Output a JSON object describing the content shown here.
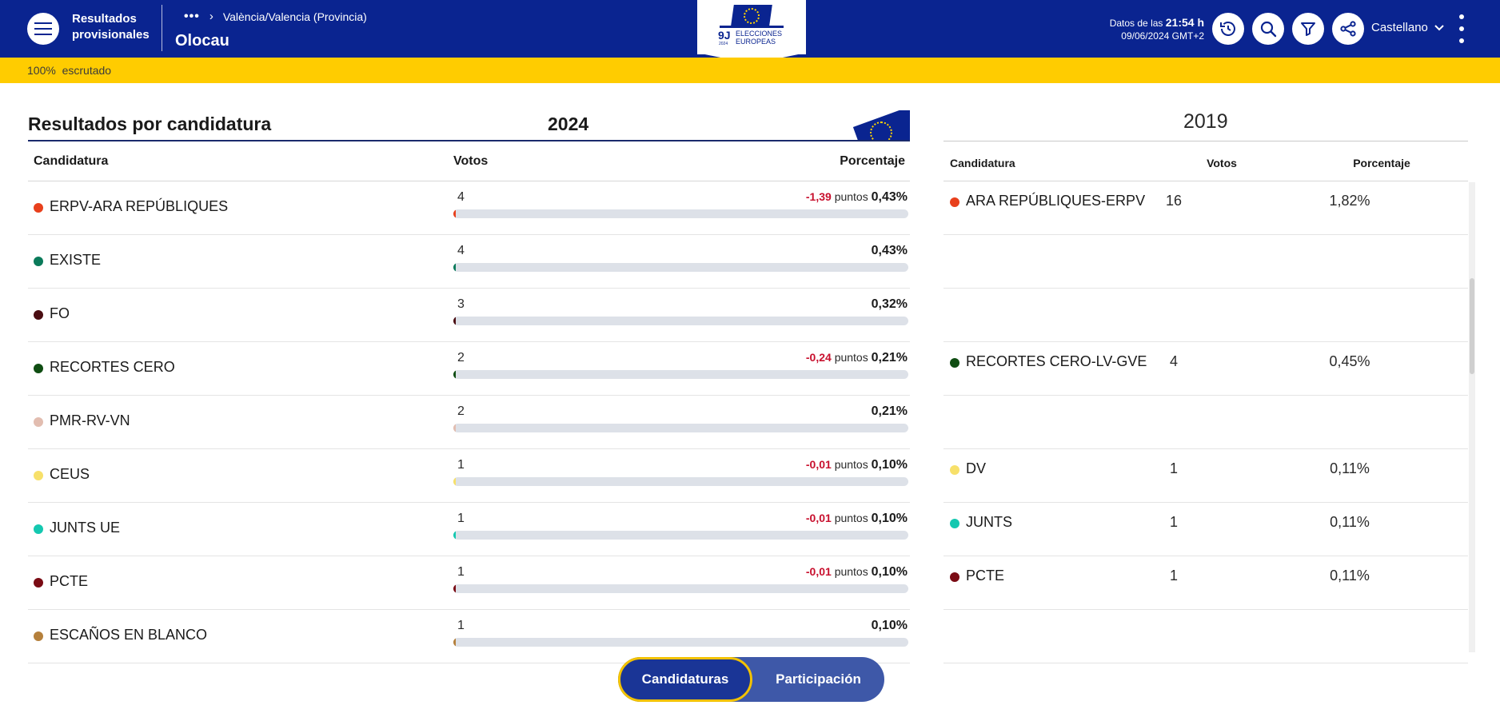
{
  "header": {
    "brand": "Resultados provisionales",
    "breadcrumb_more": "•••",
    "breadcrumb_item": "València/Valencia (Provincia)",
    "place": "Olocau",
    "logo": {
      "badge": "9J",
      "year": "2024",
      "line1": "ELECCIONES",
      "line2": "EUROPEAS"
    },
    "data_prefix": "Datos de las",
    "data_time": "21:54 h",
    "data_date": "09/06/2024 GMT+2",
    "language": "Castellano",
    "icons": [
      "history-icon",
      "search-icon",
      "filter-icon",
      "share-icon"
    ]
  },
  "status": {
    "percent": "100%",
    "label": "escrutado"
  },
  "section": {
    "title": "Resultados por candidatura",
    "year_current": "2024",
    "year_previous": "2019"
  },
  "table_2024": {
    "headers": [
      "Candidatura",
      "Votos",
      "Porcentaje"
    ],
    "delta_unit": "puntos",
    "rows": [
      {
        "name": "ERPV-ARA REPÚBLIQUES",
        "votes": "4",
        "delta": "-1,39",
        "pct": "0,43%",
        "pct_value": 0.43,
        "color": "#e8401c"
      },
      {
        "name": "EXISTE",
        "votes": "4",
        "delta": "",
        "pct": "0,43%",
        "pct_value": 0.43,
        "color": "#0a7a5a"
      },
      {
        "name": "FO",
        "votes": "3",
        "delta": "",
        "pct": "0,32%",
        "pct_value": 0.32,
        "color": "#4a0d12"
      },
      {
        "name": "RECORTES CERO",
        "votes": "2",
        "delta": "-0,24",
        "pct": "0,21%",
        "pct_value": 0.21,
        "color": "#0f4d12"
      },
      {
        "name": "PMR-RV-VN",
        "votes": "2",
        "delta": "",
        "pct": "0,21%",
        "pct_value": 0.21,
        "color": "#e2bdb0"
      },
      {
        "name": "CEUS",
        "votes": "1",
        "delta": "-0,01",
        "pct": "0,10%",
        "pct_value": 0.1,
        "color": "#f7e06a"
      },
      {
        "name": "JUNTS UE",
        "votes": "1",
        "delta": "-0,01",
        "pct": "0,10%",
        "pct_value": 0.1,
        "color": "#14c8b0"
      },
      {
        "name": "PCTE",
        "votes": "1",
        "delta": "-0,01",
        "pct": "0,10%",
        "pct_value": 0.1,
        "color": "#7a0b14"
      },
      {
        "name": "ESCAÑOS EN BLANCO",
        "votes": "1",
        "delta": "",
        "pct": "0,10%",
        "pct_value": 0.1,
        "color": "#b5803c"
      }
    ]
  },
  "table_2019": {
    "headers": [
      "Candidatura",
      "Votos",
      "Porcentaje"
    ],
    "rows": [
      {
        "name": "ARA REPÚBLIQUES-ERPV",
        "votes": "16",
        "pct": "1,82%",
        "color": "#e8401c"
      },
      {
        "name": "",
        "votes": "",
        "pct": "",
        "color": ""
      },
      {
        "name": "",
        "votes": "",
        "pct": "",
        "color": ""
      },
      {
        "name": "RECORTES CERO-LV-GVE",
        "votes": "4",
        "pct": "0,45%",
        "color": "#0f4d12"
      },
      {
        "name": "",
        "votes": "",
        "pct": "",
        "color": ""
      },
      {
        "name": "DV",
        "votes": "1",
        "pct": "0,11%",
        "color": "#f7e06a"
      },
      {
        "name": "JUNTS",
        "votes": "1",
        "pct": "0,11%",
        "color": "#14c8b0"
      },
      {
        "name": "PCTE",
        "votes": "1",
        "pct": "0,11%",
        "color": "#7a0b14"
      },
      {
        "name": "",
        "votes": "",
        "pct": "",
        "color": ""
      }
    ]
  },
  "toggle": {
    "active": "Candidaturas",
    "inactive": "Participación"
  }
}
